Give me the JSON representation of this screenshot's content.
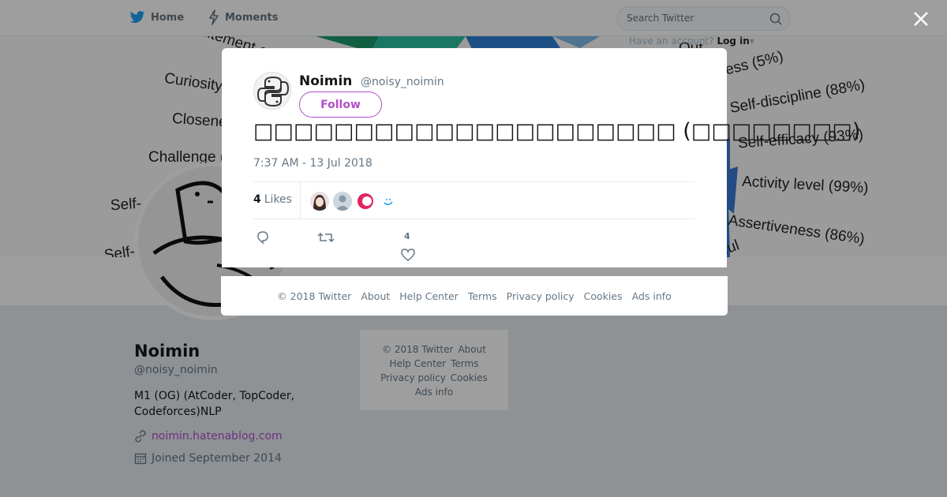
{
  "nav": {
    "home_label": "Home",
    "moments_label": "Moments",
    "search_placeholder": "Search Twitter",
    "have_account": "Have an account?",
    "login_label": "Log in"
  },
  "banner": {
    "labels": [
      "Excitement-seeking (41%)",
      "Curiosity",
      "Closeness",
      "Challenge (",
      "Self-",
      "Self-",
      "ness (5%)",
      "Self-discipline (88%)",
      "Self-efficacy (93%)",
      "Activity level (99%)",
      "Assertiveness (86%)",
      "eerful",
      "Out"
    ]
  },
  "profile": {
    "name": "Noimin",
    "handle": "@noisy_noimin",
    "bio": "M1 (OG) (AtCoder, TopCoder, Codeforces)NLP",
    "link": "noimin.hatenablog.com",
    "joined": "Joined September 2014"
  },
  "side_footer": {
    "items": [
      "© 2018 Twitter",
      "About",
      "Help Center",
      "Terms",
      "Privacy policy",
      "Cookies",
      "Ads info"
    ]
  },
  "tweet": {
    "name": "Noimin",
    "handle": "@noisy_noimin",
    "follow_label": "Follow",
    "text": "□□□□□□□□□□□□□□□□□□□□□ (□□□□□□□□)",
    "time": "7:37 AM - 13 Jul 2018",
    "likes_count": "4",
    "likes_label": "Likes",
    "like_action_count": "4",
    "likers": [
      "liker-1",
      "liker-2",
      "liker-3",
      "liker-4"
    ]
  },
  "modal_footer": {
    "items": [
      "© 2018 Twitter",
      "About",
      "Help Center",
      "Terms",
      "Privacy policy",
      "Cookies",
      "Ads info"
    ]
  },
  "colors": {
    "accent": "#b24ecb",
    "twitter_blue": "#1da1f2",
    "text_secondary": "#657786"
  }
}
